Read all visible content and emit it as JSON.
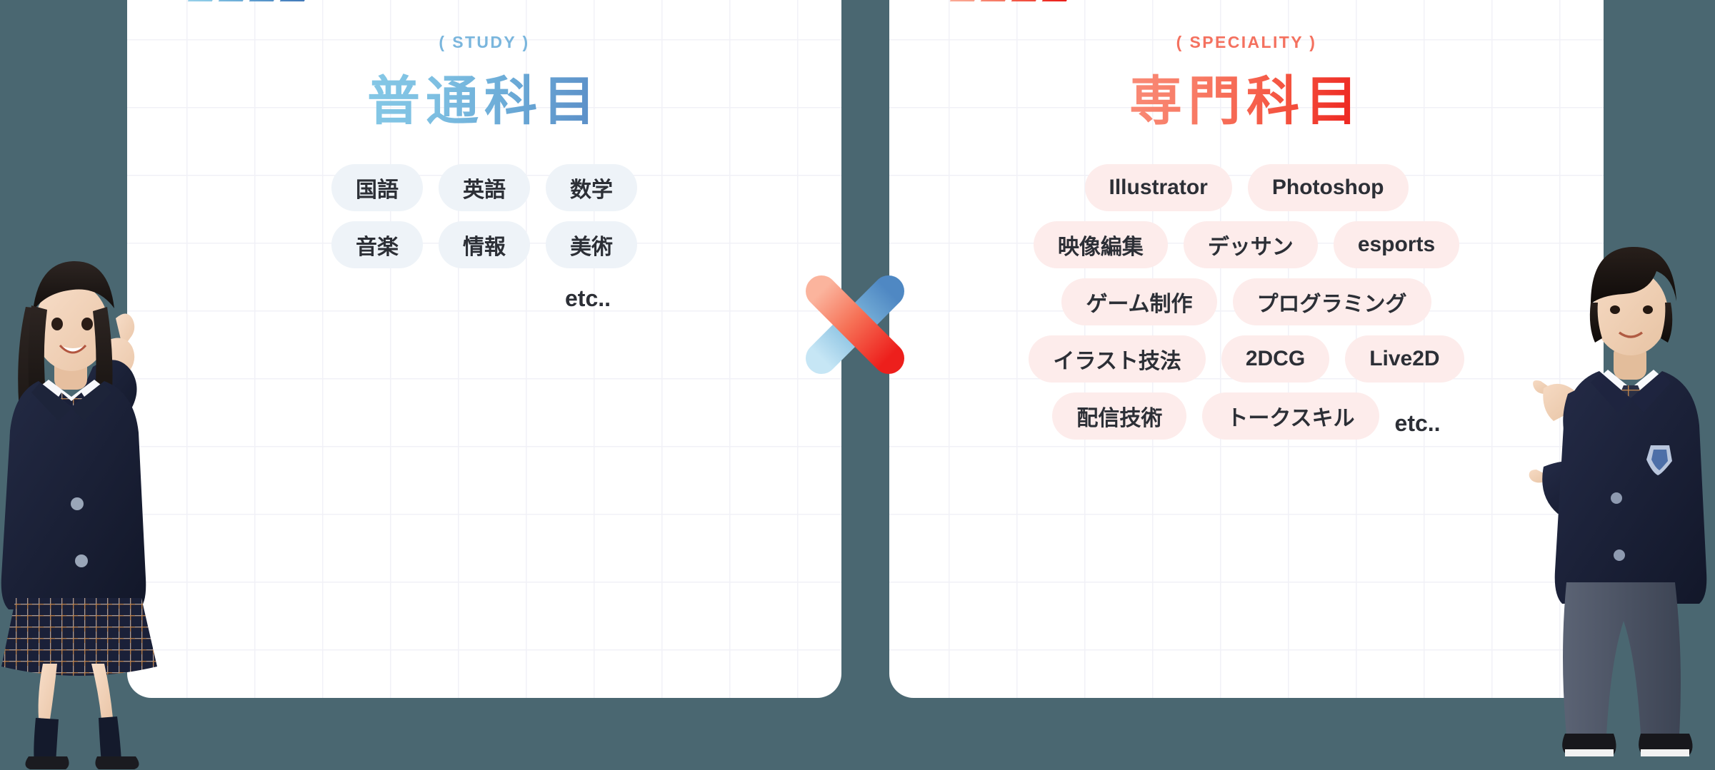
{
  "theme": {
    "page_background": "#4a6771",
    "card_background": "#ffffff",
    "grid_line": "#f1f1f7",
    "blue_accent": "#7ab6dd",
    "blue_deep": "#5a8cc6",
    "red_accent": "#f4715f",
    "red_deep": "#ec1f1c",
    "pill_blue_bg": "#eef3f8",
    "pill_red_bg": "#fdeceb",
    "pill_text": "#2c2f36"
  },
  "cards": [
    {
      "eyebrow": "( STUDY )",
      "heading": "普通科目",
      "etc": "etc..",
      "rows": [
        [
          "国語",
          "英語",
          "数学"
        ],
        [
          "音楽",
          "情報",
          "美術"
        ]
      ]
    },
    {
      "eyebrow": "( SPECIALITY )",
      "heading": "専門科目",
      "etc": "etc..",
      "rows": [
        [
          "Illustrator",
          "Photoshop"
        ],
        [
          "映像編集",
          "デッサン",
          "esports"
        ],
        [
          "ゲーム制作",
          "プログラミング"
        ],
        [
          "イラスト技法",
          "2DCG",
          "Live2D"
        ],
        [
          "配信技術",
          "トークスキル"
        ]
      ]
    }
  ],
  "cross": {
    "name": "cross-multiply-symbol",
    "blue_from": "#bfe2f3",
    "blue_to": "#4f88c3",
    "red_from": "#fbab93",
    "red_to": "#ed1f1c"
  },
  "students": {
    "left": {
      "label": "female-student-pointing-up",
      "hair": "#26201e",
      "blazer": "#1a2038",
      "skin": "#f3d2b9"
    },
    "right": {
      "label": "male-student-pointing-left",
      "hair": "#1b1613",
      "blazer": "#1c2239",
      "skin": "#f2cfb2"
    }
  }
}
